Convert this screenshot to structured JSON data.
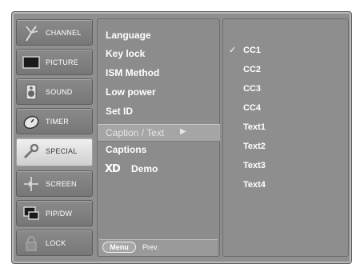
{
  "categories": [
    {
      "label": "CHANNEL",
      "icon": "antenna-icon"
    },
    {
      "label": "PICTURE",
      "icon": "monitor-icon"
    },
    {
      "label": "SOUND",
      "icon": "speaker-icon"
    },
    {
      "label": "TIMER",
      "icon": "clock-icon"
    },
    {
      "label": "SPECIAL",
      "icon": "wrench-icon"
    },
    {
      "label": "SCREEN",
      "icon": "crosshair-icon"
    },
    {
      "label": "PIP/DW",
      "icon": "pip-window-icon"
    },
    {
      "label": "LOCK",
      "icon": "lock-icon"
    }
  ],
  "active_category": "SPECIAL",
  "special_menu": {
    "items": [
      "Language",
      "Key lock",
      "ISM Method",
      "Low power",
      "Set ID"
    ],
    "highlighted": "Caption / Text",
    "after_items": [
      "Captions"
    ],
    "xd_logo": "XD",
    "xd_label": "Demo"
  },
  "footer": {
    "menu_label": "Menu",
    "prev_label": "Prev."
  },
  "caption_options": {
    "selected": "CC1",
    "check": "✓",
    "items": [
      "CC1",
      "CC2",
      "CC3",
      "CC4",
      "Text1",
      "Text2",
      "Text3",
      "Text4"
    ]
  }
}
